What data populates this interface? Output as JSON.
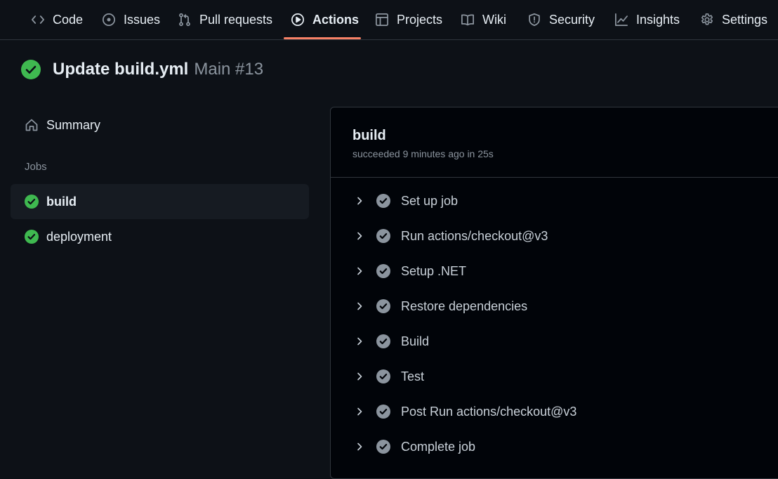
{
  "nav": {
    "tabs": [
      {
        "label": "Code",
        "icon": "code-icon"
      },
      {
        "label": "Issues",
        "icon": "issue-icon"
      },
      {
        "label": "Pull requests",
        "icon": "pull-request-icon"
      },
      {
        "label": "Actions",
        "icon": "play-icon",
        "active": true
      },
      {
        "label": "Projects",
        "icon": "table-icon"
      },
      {
        "label": "Wiki",
        "icon": "book-icon"
      },
      {
        "label": "Security",
        "icon": "shield-icon"
      },
      {
        "label": "Insights",
        "icon": "graph-icon"
      },
      {
        "label": "Settings",
        "icon": "gear-icon"
      }
    ]
  },
  "run": {
    "title": "Update build.yml",
    "workflow_and_number": "Main #13",
    "status": "success"
  },
  "sidebar": {
    "summary_label": "Summary",
    "jobs_label": "Jobs",
    "jobs": [
      {
        "label": "build",
        "status": "success",
        "selected": true
      },
      {
        "label": "deployment",
        "status": "success",
        "selected": false
      }
    ]
  },
  "job": {
    "title": "build",
    "meta": "succeeded 9 minutes ago in 25s",
    "steps": [
      {
        "label": "Set up job",
        "status": "success"
      },
      {
        "label": "Run actions/checkout@v3",
        "status": "success"
      },
      {
        "label": "Setup .NET",
        "status": "success"
      },
      {
        "label": "Restore dependencies",
        "status": "success"
      },
      {
        "label": "Build",
        "status": "success"
      },
      {
        "label": "Test",
        "status": "success"
      },
      {
        "label": "Post Run actions/checkout@v3",
        "status": "success"
      },
      {
        "label": "Complete job",
        "status": "success"
      }
    ]
  },
  "colors": {
    "background": "#0d1117",
    "panel": "#010409",
    "success": "#3fb950",
    "step_check": "#8b949e",
    "tab_underline": "#f78166",
    "muted_text": "#8b949e"
  }
}
